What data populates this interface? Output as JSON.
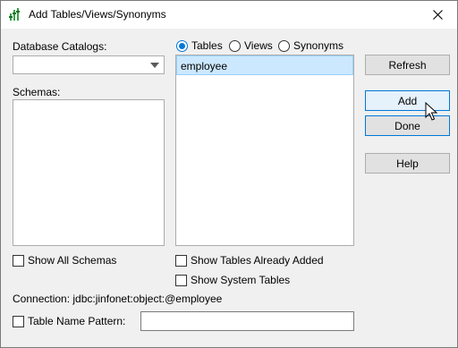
{
  "window": {
    "title": "Add Tables/Views/Synonyms",
    "app_icon": "report-builder-icon",
    "close_icon": "close-icon"
  },
  "catalogs": {
    "label": "Database Catalogs:",
    "selected_value": ""
  },
  "schemas": {
    "label": "Schemas:",
    "items": [],
    "show_all_label": "Show All Schemas",
    "show_all_checked": false
  },
  "object_type": {
    "options": [
      {
        "label": "Tables",
        "checked": true
      },
      {
        "label": "Views",
        "checked": false
      },
      {
        "label": "Synonyms",
        "checked": false
      }
    ]
  },
  "tables": {
    "items": [
      "employee"
    ],
    "selected_index": 0,
    "show_added_label": "Show Tables Already Added",
    "show_added_checked": false,
    "show_system_label": "Show System Tables",
    "show_system_checked": false
  },
  "buttons": {
    "refresh": "Refresh",
    "add": "Add",
    "done": "Done",
    "help": "Help"
  },
  "connection": {
    "text": "Connection: jdbc:jinfonet:object:@employee"
  },
  "pattern": {
    "label": "Table Name Pattern:",
    "checked": false,
    "value": ""
  },
  "colors": {
    "accent": "#0078d7",
    "selection_bg": "#cce8ff",
    "dialog_bg": "#f0f0f0"
  }
}
